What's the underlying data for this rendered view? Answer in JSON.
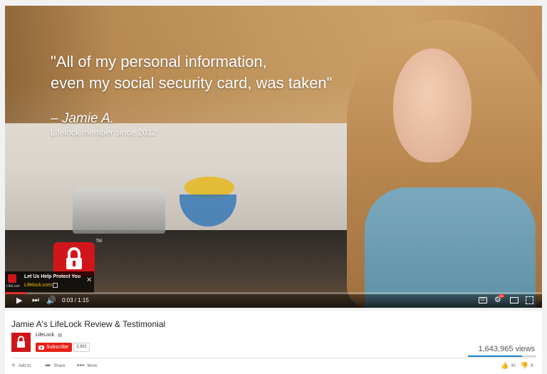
{
  "video": {
    "quote_line1": "\"All of my personal information,",
    "quote_line2": "even my social security card, was taken\"",
    "author": "– Jamie A.",
    "since": "Lifelock member since 2012",
    "ad_title": "Let Us Help Protect You",
    "ad_url": "Lifelock.com",
    "ad_logo_label": "LifeLock",
    "time": "0:03 / 1:15",
    "progress": 0.04,
    "cc_label": "CC",
    "hd_label": "HD"
  },
  "info": {
    "title": "Jamie A's LifeLock Review & Testimonial",
    "channel_name": "LifeLock",
    "subscribe_label": "Subscribe",
    "subscriber_count": "3,981",
    "views": "1,643,965 views",
    "like_ratio": 0.79,
    "actions": {
      "add_to": "Add to",
      "share": "Share",
      "more": "More"
    },
    "likes": "30",
    "dislikes": "8"
  },
  "colors": {
    "brand_red": "#d1161b",
    "youtube_red": "#e62117",
    "progress_red": "#e52d27",
    "like_bar_blue": "#167ac6"
  }
}
